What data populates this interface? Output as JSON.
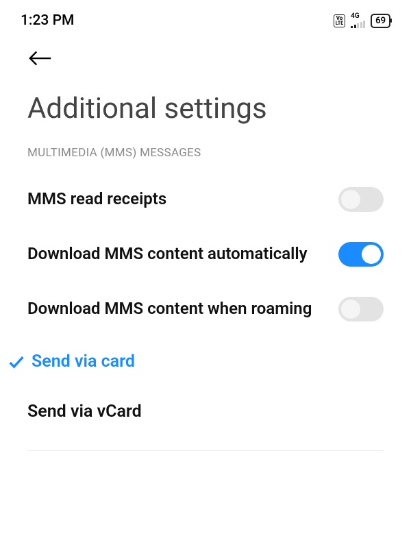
{
  "status": {
    "time": "1:23 PM",
    "network_type": "4G",
    "battery": "69"
  },
  "page": {
    "title": "Additional settings"
  },
  "section": {
    "header": "MULTIMEDIA (MMS) MESSAGES"
  },
  "settings": {
    "mms_read_receipts": {
      "label": "MMS read receipts",
      "enabled": false
    },
    "download_mms_auto": {
      "label": "Download MMS content automatically",
      "enabled": true
    },
    "download_mms_roaming": {
      "label": "Download MMS content when roaming",
      "enabled": false
    }
  },
  "options": {
    "send_via_card": {
      "label": "Send via card",
      "selected": true
    },
    "send_via_vcard": {
      "label": "Send via vCard",
      "selected": false
    }
  }
}
